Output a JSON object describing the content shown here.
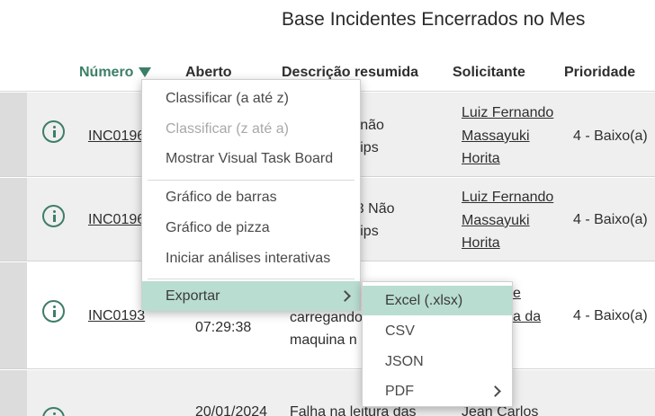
{
  "page_title": "Base Incidentes Encerrados no Mes",
  "columns": {
    "numero": "Número",
    "aberto": "Aberto",
    "descricao": "Descrição resumida",
    "solicitante": "Solicitante",
    "prioridade": "Prioridade"
  },
  "rows": [
    {
      "number": "INC0196",
      "desc_line1": "14 não",
      "desc_line2": "o Tips",
      "requester_line1": "Luiz Fernando",
      "requester_line2": "Massayuki",
      "requester_line3": "Horita",
      "priority": "4 - Baixo(a)"
    },
    {
      "number": "INC0196",
      "desc_line1": "423 Não",
      "desc_line2": "o Tips",
      "requester_line1": "Luiz Fernando",
      "requester_line2": "Massayuki",
      "requester_line3": "Horita",
      "priority": "4 - Baixo(a)"
    },
    {
      "number": "INC0193",
      "opened_time": "07:29:38",
      "desc_line1": "carregando",
      "desc_line2": "maquina n",
      "requester_line1": "e",
      "requester_line2": "a da",
      "priority": "4 - Baixo(a)"
    },
    {
      "opened": "20/01/2024",
      "desc_line1": "Falha na leitura das",
      "requester_line1": "Jean Carlos"
    }
  ],
  "context_menu": {
    "sort_asc": "Classificar (a até z)",
    "sort_desc": "Classificar (z até a)",
    "visual_task_board": "Mostrar Visual Task Board",
    "bar_chart": "Gráfico de barras",
    "pie_chart": "Gráfico de pizza",
    "interactive_analysis": "Iniciar análises interativas",
    "export": "Exportar"
  },
  "export_submenu": {
    "excel": "Excel (.xlsx)",
    "csv": "CSV",
    "json": "JSON",
    "pdf": "PDF"
  },
  "colors": {
    "accent": "#3d7f66",
    "menu_highlight": "#b9ddd0",
    "row_alt": "#efefef"
  }
}
